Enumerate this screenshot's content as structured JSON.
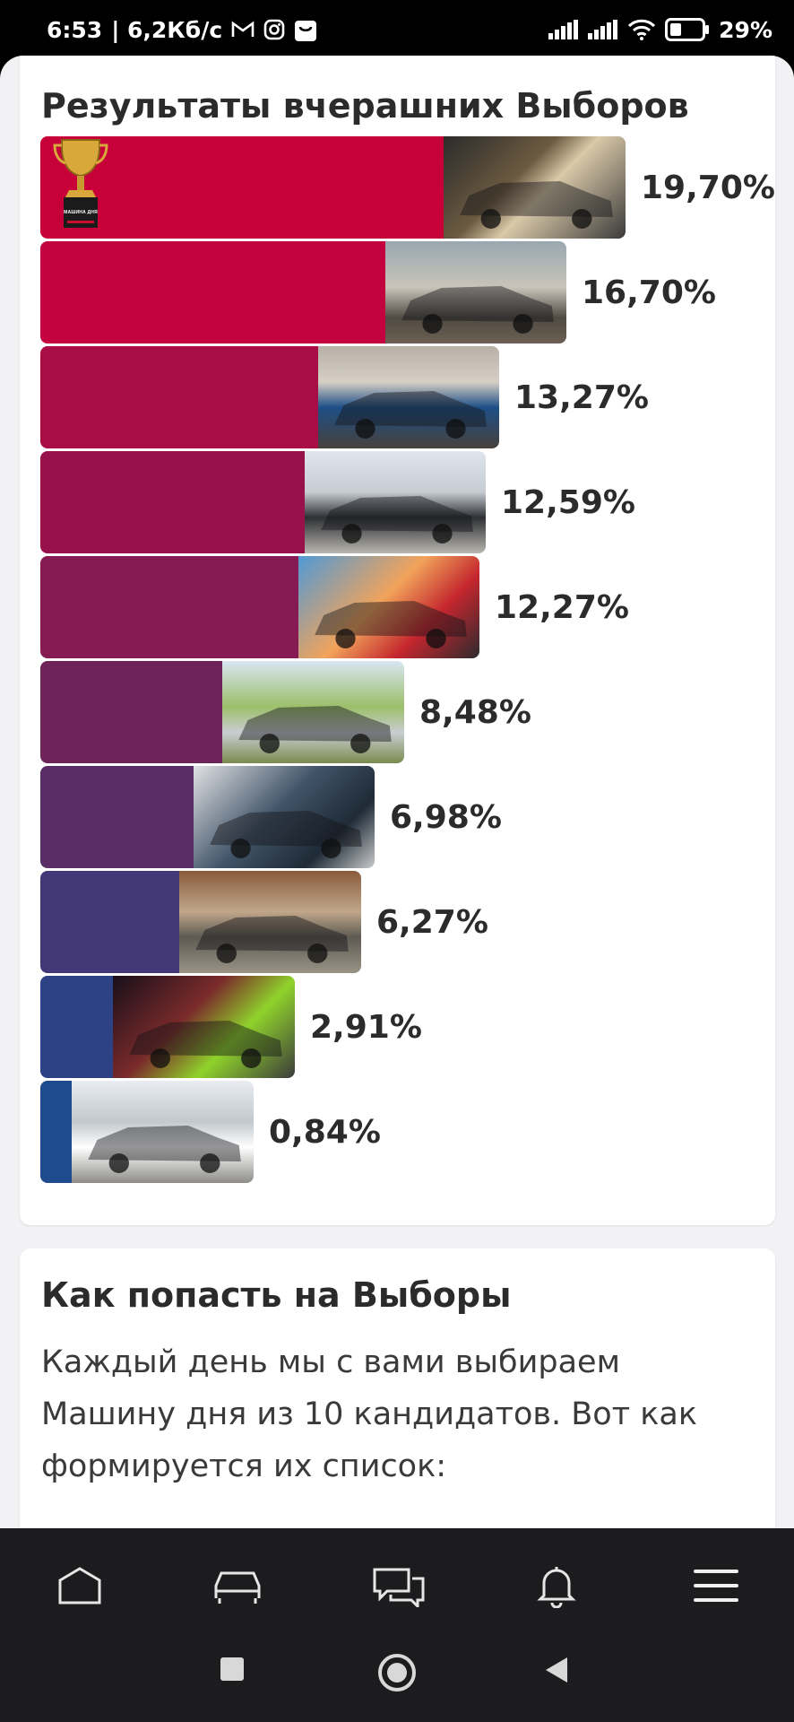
{
  "status_bar": {
    "time": "6:53",
    "network_speed": "| 6,2Кб/с",
    "battery": "29%",
    "icons": [
      "gmail-icon",
      "instagram-icon",
      "shopping-bag-icon",
      "signal-icon",
      "signal-icon",
      "wifi-icon",
      "battery-icon"
    ]
  },
  "results": {
    "title": "Результаты вчерашних Выборов",
    "trophy_caption": "МАШИНА ДНЯ",
    "items": [
      {
        "value": "19,70%",
        "share": 19.7,
        "color": "#c8003a"
      },
      {
        "value": "16,70%",
        "share": 16.7,
        "color": "#c2033f"
      },
      {
        "value": "13,27%",
        "share": 13.27,
        "color": "#a80d45"
      },
      {
        "value": "12,59%",
        "share": 12.59,
        "color": "#98114a"
      },
      {
        "value": "12,27%",
        "share": 12.27,
        "color": "#861a52"
      },
      {
        "value": "8,48%",
        "share": 8.48,
        "color": "#6e2459"
      },
      {
        "value": "6,98%",
        "share": 6.98,
        "color": "#5a2d66"
      },
      {
        "value": "6,27%",
        "share": 6.27,
        "color": "#423777"
      },
      {
        "value": "2,91%",
        "share": 2.91,
        "color": "#2d4284"
      },
      {
        "value": "0,84%",
        "share": 0.84,
        "color": "#1e4b8e"
      }
    ]
  },
  "info": {
    "title": "Как попасть на Выборы",
    "text": "Каждый день мы с вами выбираем Машину дня из 10 кандидатов. Вот как формируется их список:"
  },
  "bottom_nav": {
    "items": [
      "home-icon",
      "car-icon",
      "chat-icon",
      "bell-icon",
      "menu-icon"
    ]
  },
  "system_nav": {
    "items": [
      "recents-button",
      "home-button",
      "back-button"
    ]
  }
}
